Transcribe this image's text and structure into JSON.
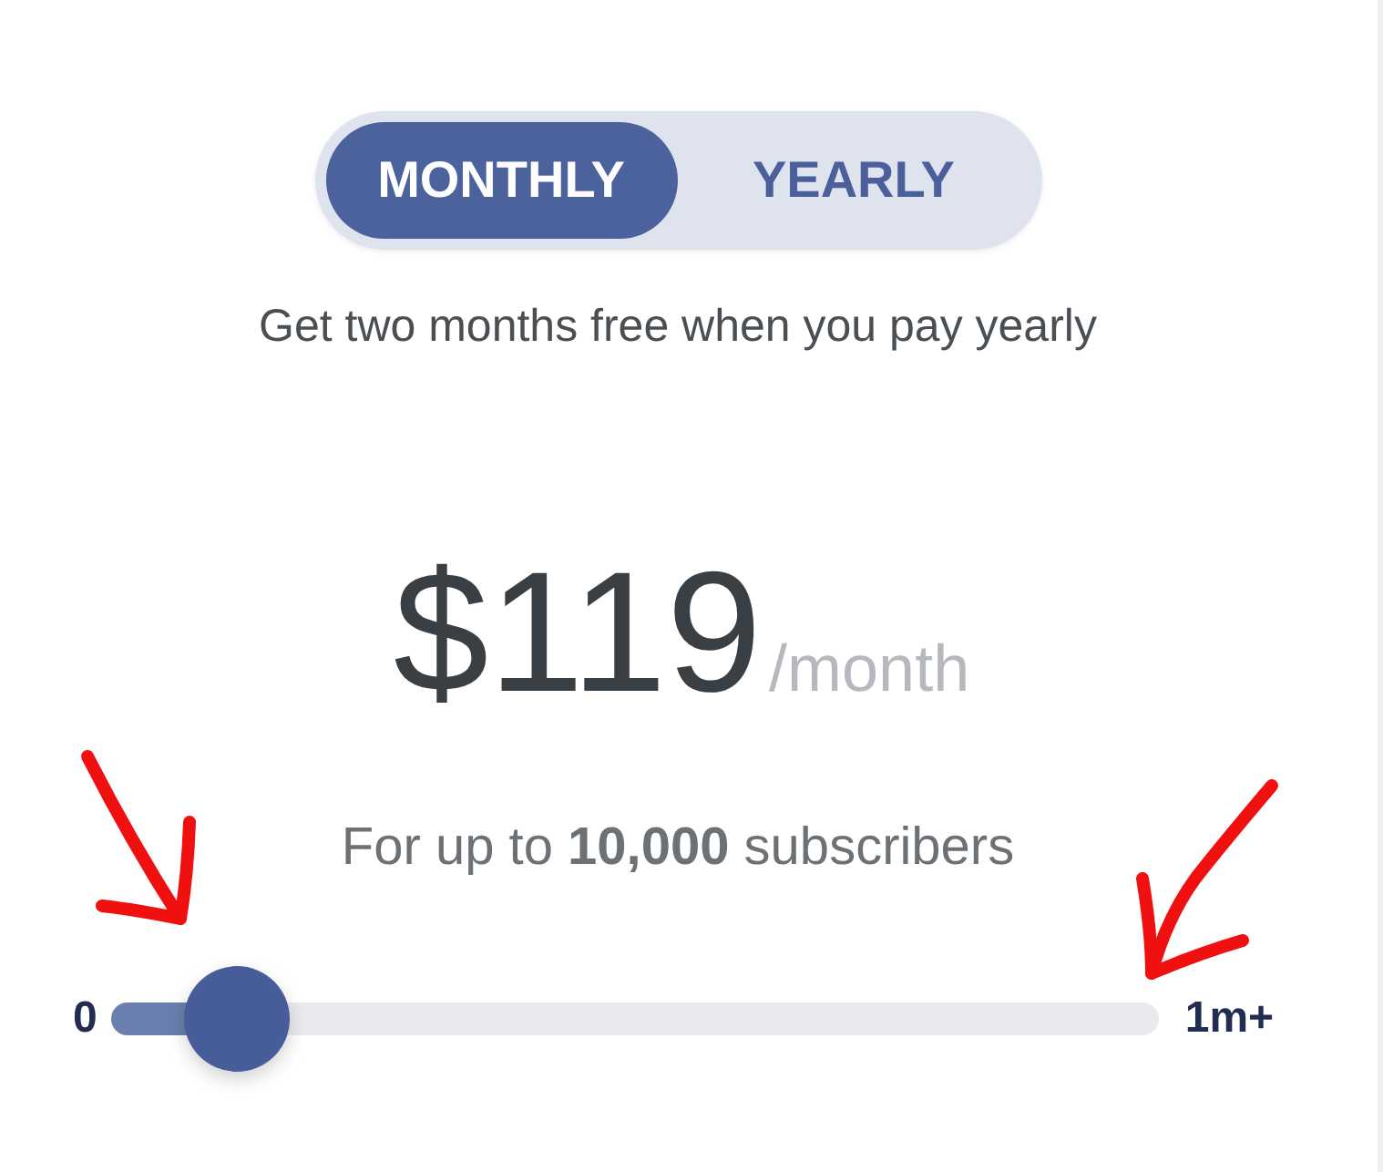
{
  "billing_toggle": {
    "options": [
      {
        "label": "MONTHLY",
        "selected": true
      },
      {
        "label": "YEARLY",
        "selected": false
      }
    ]
  },
  "promo_text": "Get two months free when you pay yearly",
  "price": {
    "amount": "$119",
    "period": "/month"
  },
  "subscribers_text": "For up to **10,000** subscribers",
  "slider": {
    "min_label": "0",
    "max_label": "1m+",
    "level": 0.12
  }
}
